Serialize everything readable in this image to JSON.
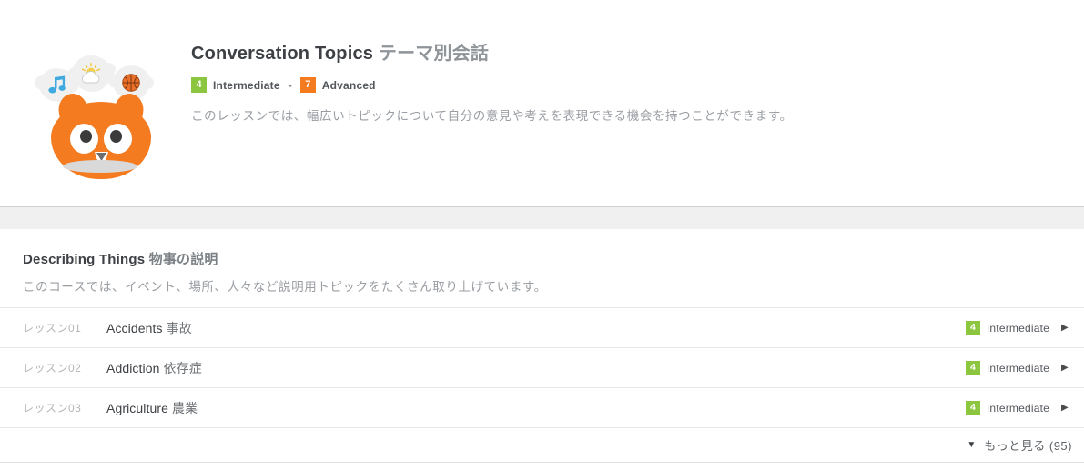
{
  "hero": {
    "title_en": "Conversation Topics",
    "title_jp": "テーマ別会話",
    "levels": {
      "from_number": "4",
      "from_label": "Intermediate",
      "separator": "-",
      "to_number": "7",
      "to_label": "Advanced"
    },
    "description": "このレッスンでは、幅広いトピックについて自分の意見や考えを表現できる機会を持つことができます。",
    "mascot": {
      "bubble_music_icon": "♫",
      "bubble_weather_icon": "⛅",
      "bubble_sport_icon": "🏀"
    },
    "colors": {
      "intermediate_green": "#8cc63f",
      "advanced_orange": "#f47b20",
      "mascot_orange": "#f47b20"
    }
  },
  "course": {
    "title_en": "Describing Things",
    "title_jp": "物事の説明",
    "description": "このコースでは、イベント、場所、人々など説明用トピックをたくさん取り上げています。",
    "lessons": [
      {
        "number": "レッスン01",
        "title_en": "Accidents",
        "title_jp": "事故",
        "level_number": "4",
        "level_label": "Intermediate",
        "chevron": "▶"
      },
      {
        "number": "レッスン02",
        "title_en": "Addiction",
        "title_jp": "依存症",
        "level_number": "4",
        "level_label": "Intermediate",
        "chevron": "▶"
      },
      {
        "number": "レッスン03",
        "title_en": "Agriculture",
        "title_jp": "農業",
        "level_number": "4",
        "level_label": "Intermediate",
        "chevron": "▶"
      }
    ],
    "more": {
      "caret": "▼",
      "label": "もっと見る (95)"
    }
  }
}
